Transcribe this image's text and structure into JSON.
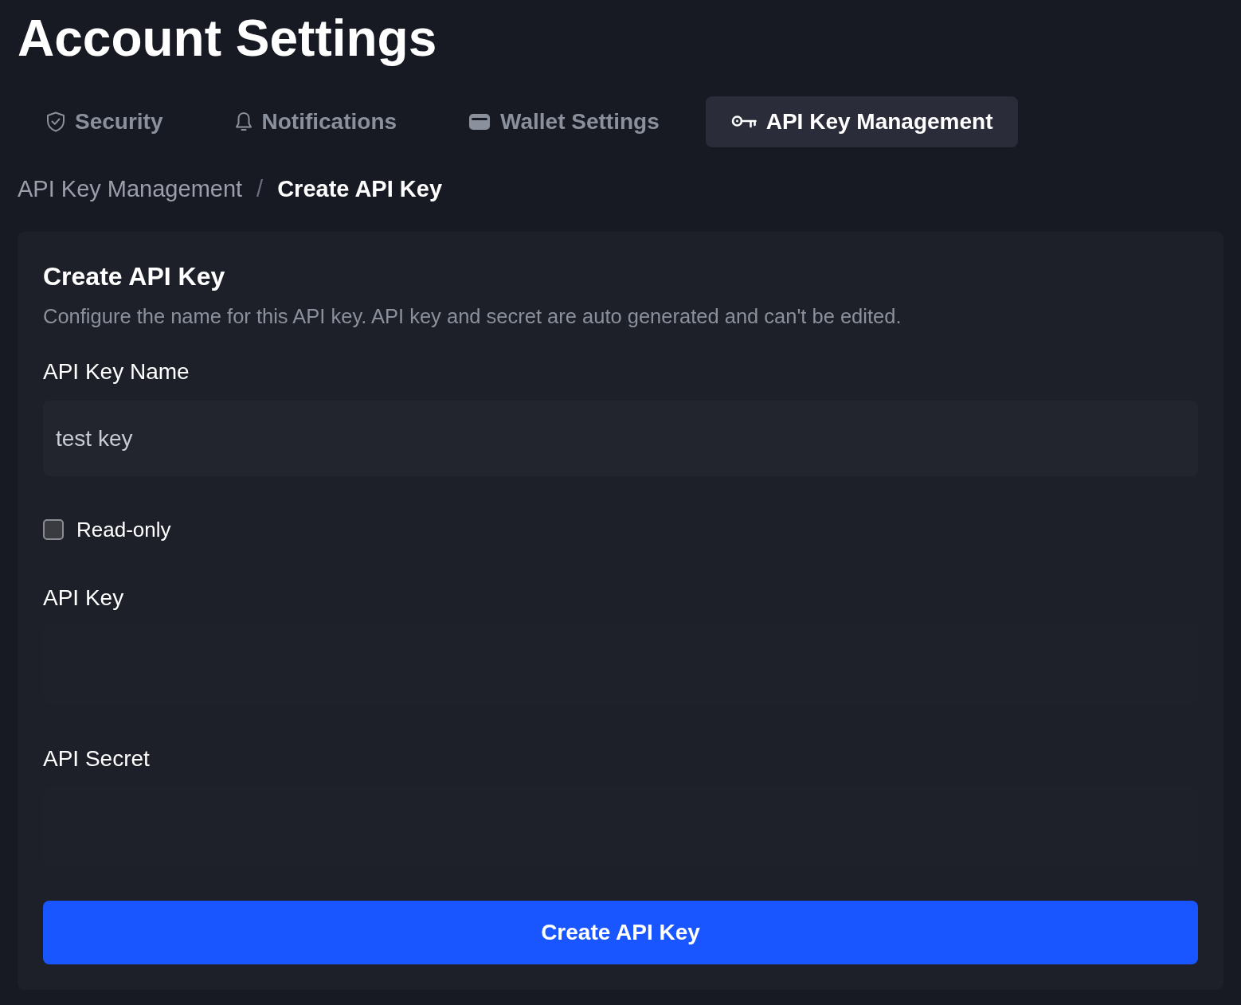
{
  "page": {
    "title": "Account Settings"
  },
  "tabs": [
    {
      "kind": "shield",
      "label": "Security",
      "selected": false
    },
    {
      "kind": "bell",
      "label": "Notifications",
      "selected": false
    },
    {
      "kind": "wallet",
      "label": "Wallet Settings",
      "selected": false
    },
    {
      "kind": "key",
      "label": "API Key Management",
      "selected": true
    }
  ],
  "breadcrumb": {
    "items": [
      {
        "label": "API Key Management",
        "current": false
      },
      {
        "label": "Create API Key",
        "current": true
      }
    ],
    "separator": "/"
  },
  "card": {
    "title": "Create API Key",
    "description": "Configure the name for this API key. API key and secret are auto generated and can't be edited.",
    "fields": [
      {
        "kind": "text",
        "label": "API Key Name",
        "value": "test key"
      },
      {
        "kind": "checkbox",
        "label": "Read-only",
        "checked": false
      },
      {
        "kind": "readonly",
        "label": "API Key"
      },
      {
        "kind": "readonly",
        "label": "API Secret"
      }
    ],
    "submit": {
      "label": "Create API Key"
    }
  }
}
